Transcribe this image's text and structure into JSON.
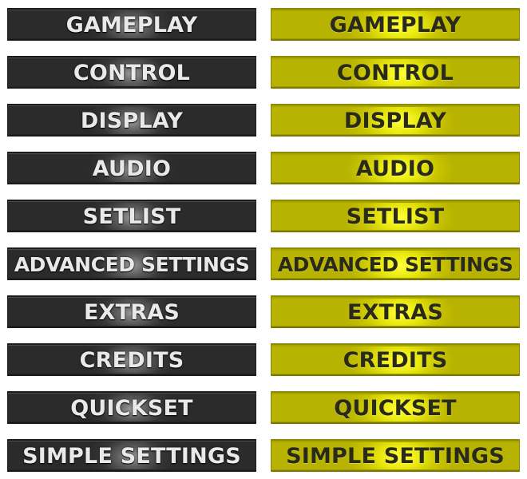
{
  "menu_normal": {
    "items": [
      {
        "label": "GAMEPLAY"
      },
      {
        "label": "CONTROL"
      },
      {
        "label": "DISPLAY"
      },
      {
        "label": "AUDIO"
      },
      {
        "label": "SETLIST"
      },
      {
        "label": "ADVANCED SETTINGS"
      },
      {
        "label": "EXTRAS"
      },
      {
        "label": "CREDITS"
      },
      {
        "label": "QUICKSET"
      },
      {
        "label": "SIMPLE SETTINGS"
      }
    ]
  },
  "menu_highlighted": {
    "items": [
      {
        "label": "GAMEPLAY"
      },
      {
        "label": "CONTROL"
      },
      {
        "label": "DISPLAY"
      },
      {
        "label": "AUDIO"
      },
      {
        "label": "SETLIST"
      },
      {
        "label": "ADVANCED SETTINGS"
      },
      {
        "label": "EXTRAS"
      },
      {
        "label": "CREDITS"
      },
      {
        "label": "QUICKSET"
      },
      {
        "label": "SIMPLE SETTINGS"
      }
    ]
  },
  "colors": {
    "normal_button": "#2b2b2b",
    "normal_text": "#e9e9e9",
    "highlight_button": "#e6e000",
    "highlight_text": "#2a2a1a"
  }
}
